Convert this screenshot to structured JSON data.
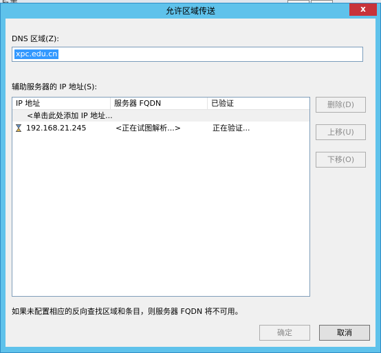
{
  "window": {
    "title": "允许区域传送",
    "close_label": "x"
  },
  "background": {
    "partial_text": "反表"
  },
  "zone": {
    "label": "DNS 区域(Z):",
    "value": "xpc.edu.cn"
  },
  "servers": {
    "label": "辅助服务器的 IP 地址(S):",
    "columns": [
      "IP 地址",
      "服务器 FQDN",
      "已验证"
    ],
    "add_placeholder": "<单击此处添加 IP 地址...",
    "rows": [
      {
        "icon": "hourglass-icon",
        "ip": "192.168.21.245",
        "fqdn": "<正在试图解析...>",
        "verified": "正在验证..."
      }
    ]
  },
  "buttons": {
    "delete": "删除(D)",
    "up": "上移(U)",
    "down": "下移(O)",
    "ok": "确定",
    "cancel": "取消"
  },
  "note": "如果未配置相应的反向查找区域和条目，则服务器 FQDN 将不可用。",
  "colors": {
    "title_bar": "#5fc2eb",
    "close": "#c8333a",
    "selection": "#3399ff"
  }
}
